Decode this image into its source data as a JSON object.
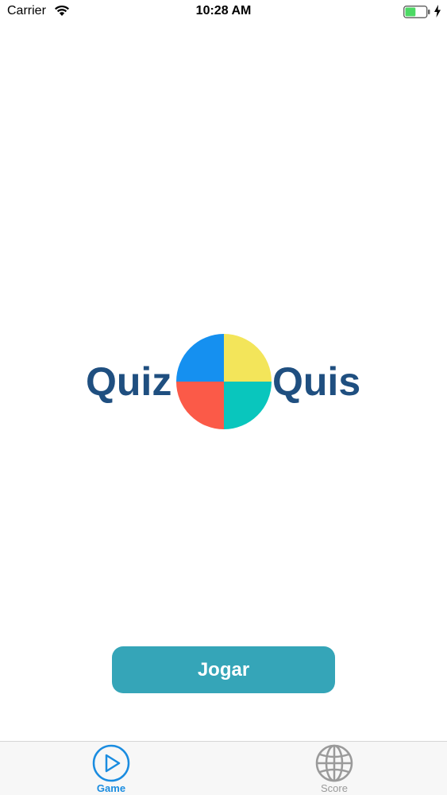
{
  "status_bar": {
    "carrier": "Carrier",
    "time": "10:28 AM",
    "battery_fill": 0.5
  },
  "logo": {
    "left_word": "Quiz",
    "right_word": "Quis",
    "colors": {
      "text": "#1f4f80",
      "top_left": "#1590f0",
      "top_right": "#f3e55a",
      "bottom_left": "#fb5a48",
      "bottom_right": "#09c6bd"
    }
  },
  "main": {
    "play_label": "Jogar",
    "play_color": "#35a5b8"
  },
  "tab_bar": {
    "tabs": [
      {
        "label": "Game",
        "icon": "play-circle-icon",
        "selected": true
      },
      {
        "label": "Score",
        "icon": "globe-icon",
        "selected": false
      }
    ],
    "active_color": "#1a8ce0",
    "inactive_color": "#9a9a9a"
  }
}
